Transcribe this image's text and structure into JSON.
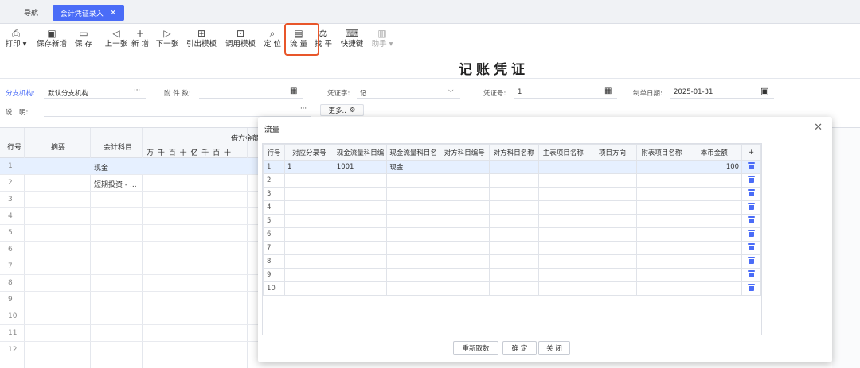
{
  "tabs": {
    "nav": "导航",
    "active": "会计凭证录入",
    "close": "✕"
  },
  "toolbar": [
    {
      "name": "print",
      "icon": "⎙",
      "label": "打印 ▾"
    },
    {
      "name": "save-new",
      "icon": "▣",
      "label": "保存新增"
    },
    {
      "name": "save",
      "icon": "▭",
      "label": "保 存"
    },
    {
      "name": "prev",
      "icon": "◁",
      "label": "上一张"
    },
    {
      "name": "new",
      "icon": "+",
      "label": "新 增"
    },
    {
      "name": "next",
      "icon": "▷",
      "label": "下一张"
    },
    {
      "name": "import-template",
      "icon": "⊞",
      "label": "引出模板"
    },
    {
      "name": "use-template",
      "icon": "⊡",
      "label": "调用模板"
    },
    {
      "name": "locate",
      "icon": "⌕",
      "label": "定 位"
    },
    {
      "name": "cashflow",
      "icon": "▤",
      "label": "流 量"
    },
    {
      "name": "balance",
      "icon": "⚖",
      "label": "找 平"
    },
    {
      "name": "shortcut",
      "icon": "⌨",
      "label": "快捷键"
    },
    {
      "name": "assistant",
      "icon": "▥",
      "label": "助手 ▾"
    }
  ],
  "page_title": "记账凭证",
  "form": {
    "branch_label": "分支机构:",
    "branch_value": "默认分支机构",
    "branch_more": "···",
    "attach_label": "附 件 数:",
    "voucher_word_label": "凭证字:",
    "voucher_word_value": "记",
    "voucher_no_label": "凭证号:",
    "voucher_no_value": "1",
    "date_label": "制单日期:",
    "date_value": "2025-01-31",
    "memo_label": "说　明:",
    "memo_more": "···",
    "more_label": "更多..",
    "gear": "⚙"
  },
  "bg_grid": {
    "headers": {
      "row": "行号",
      "summary": "摘要",
      "account": "会计科目",
      "debit": "借方金额",
      "digits": "万 千 百 十 亿 千 百 十"
    },
    "rows": [
      {
        "n": "1",
        "account": "现金"
      },
      {
        "n": "2",
        "account": "短期投资 - ..."
      },
      {
        "n": "3",
        "account": ""
      },
      {
        "n": "4",
        "account": ""
      },
      {
        "n": "5",
        "account": ""
      },
      {
        "n": "6",
        "account": ""
      },
      {
        "n": "7",
        "account": ""
      },
      {
        "n": "8",
        "account": ""
      },
      {
        "n": "9",
        "account": ""
      },
      {
        "n": "10",
        "account": ""
      },
      {
        "n": "11",
        "account": ""
      },
      {
        "n": "12",
        "account": ""
      }
    ]
  },
  "modal": {
    "title": "流量",
    "close": "✕",
    "columns": [
      "行号",
      "对应分录号",
      "现金流量科目编",
      "现金流量科目名",
      "对方科目编号",
      "对方科目名称",
      "主表项目名称",
      "项目方向",
      "附表项目名称",
      "本币金额",
      "+"
    ],
    "rows": [
      [
        "1",
        "1",
        "1001",
        "现金",
        "",
        "",
        "",
        "",
        "",
        "100"
      ],
      [
        "2",
        "",
        "",
        "",
        "",
        "",
        "",
        "",
        "",
        ""
      ],
      [
        "3",
        "",
        "",
        "",
        "",
        "",
        "",
        "",
        "",
        ""
      ],
      [
        "4",
        "",
        "",
        "",
        "",
        "",
        "",
        "",
        "",
        ""
      ],
      [
        "5",
        "",
        "",
        "",
        "",
        "",
        "",
        "",
        "",
        ""
      ],
      [
        "6",
        "",
        "",
        "",
        "",
        "",
        "",
        "",
        "",
        ""
      ],
      [
        "7",
        "",
        "",
        "",
        "",
        "",
        "",
        "",
        "",
        ""
      ],
      [
        "8",
        "",
        "",
        "",
        "",
        "",
        "",
        "",
        "",
        ""
      ],
      [
        "9",
        "",
        "",
        "",
        "",
        "",
        "",
        "",
        "",
        ""
      ],
      [
        "10",
        "",
        "",
        "",
        "",
        "",
        "",
        "",
        "",
        ""
      ]
    ],
    "buttons": {
      "refetch": "重新取数",
      "ok": "确 定",
      "close": "关 闭"
    }
  }
}
